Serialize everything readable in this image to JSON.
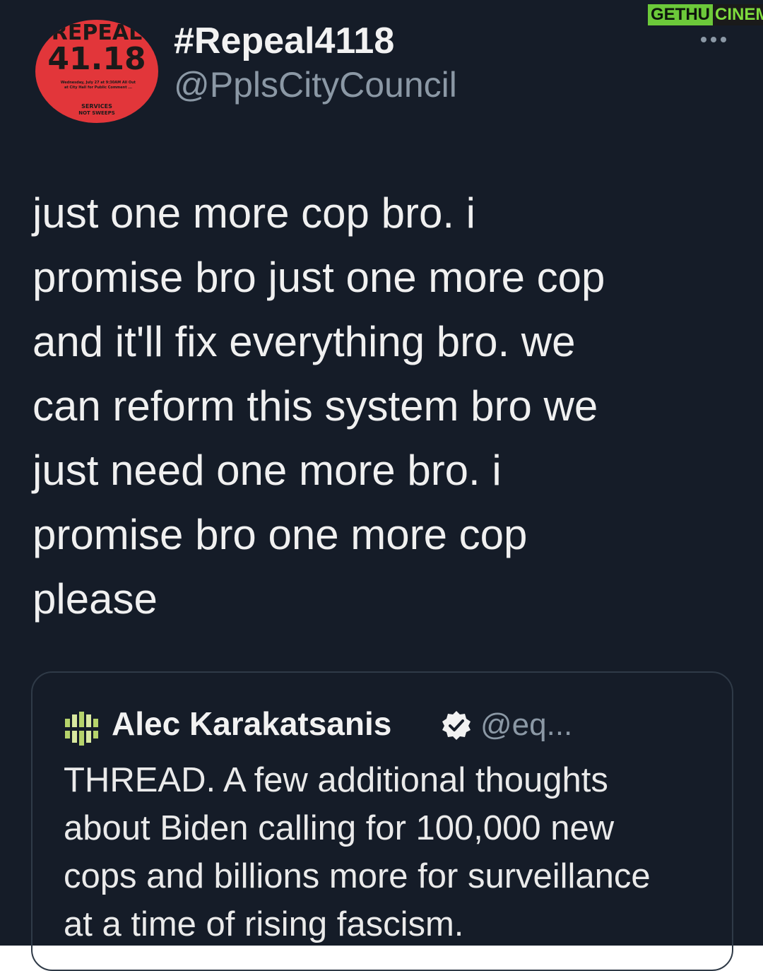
{
  "account": {
    "avatar_lines": [
      "REPEAL",
      "41.18",
      "Wednesday, July 27 at 9:30AM\nAll Out at City Hall for Public Comment\n...",
      "SERVICES",
      "NOT SWEEPS"
    ],
    "display_name": "#Repeal4118",
    "handle": "@PplsCityCouncil"
  },
  "more_icon": "more-options-icon",
  "watermark": {
    "part1": "GETHU",
    "part2": "CINEMA"
  },
  "tweet": {
    "text": "just one more cop bro. i\npromise bro just one more cop\nand it'll fix everything bro. we\ncan reform this system bro we\njust need one more bro. i\npromise bro one more cop\nplease"
  },
  "quoted_tweet": {
    "name": "Alec Karakatsanis",
    "verified_icon": "verified-badge-icon",
    "handle": "@eq...",
    "text": "THREAD.  A few additional thoughts\nabout Biden calling for 100,000 new\ncops and billions more for surveillance\nat a time of rising fascism."
  },
  "colors": {
    "background": "#151c28",
    "avatar": "#e2363a",
    "secondary_text": "#8b98a5",
    "watermark_green": "#6cc93a"
  }
}
